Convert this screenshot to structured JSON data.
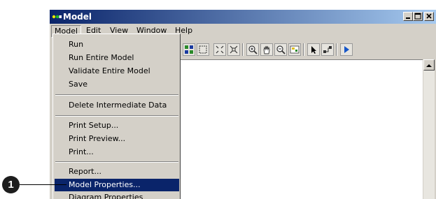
{
  "window": {
    "title": "Model"
  },
  "menubar": {
    "items": [
      {
        "label": "Model"
      },
      {
        "label": "Edit"
      },
      {
        "label": "View"
      },
      {
        "label": "Window"
      },
      {
        "label": "Help"
      }
    ]
  },
  "toolbar": {
    "tools": [
      "layout-icon",
      "full-extent-icon",
      "fixed-zoom-in-icon",
      "fixed-zoom-out-icon",
      "zoom-in-icon",
      "pan-icon",
      "zoom-out-icon",
      "overview-icon",
      "select-icon",
      "connect-icon",
      "run-icon"
    ]
  },
  "model_menu": {
    "items": [
      {
        "label": "Run"
      },
      {
        "label": "Run Entire Model"
      },
      {
        "label": "Validate Entire Model"
      },
      {
        "label": "Save"
      },
      {
        "label": "Delete Intermediate Data"
      },
      {
        "label": "Print Setup..."
      },
      {
        "label": "Print Preview..."
      },
      {
        "label": "Print..."
      },
      {
        "label": "Report..."
      },
      {
        "label": "Model Properties..."
      },
      {
        "label": "Diagram Properties"
      }
    ]
  },
  "callout": {
    "number": "1"
  },
  "colors": {
    "selection": "#0a246a",
    "titlebar_start": "#0a246a",
    "titlebar_end": "#a6caf0",
    "run_accent": "#1656c8"
  }
}
